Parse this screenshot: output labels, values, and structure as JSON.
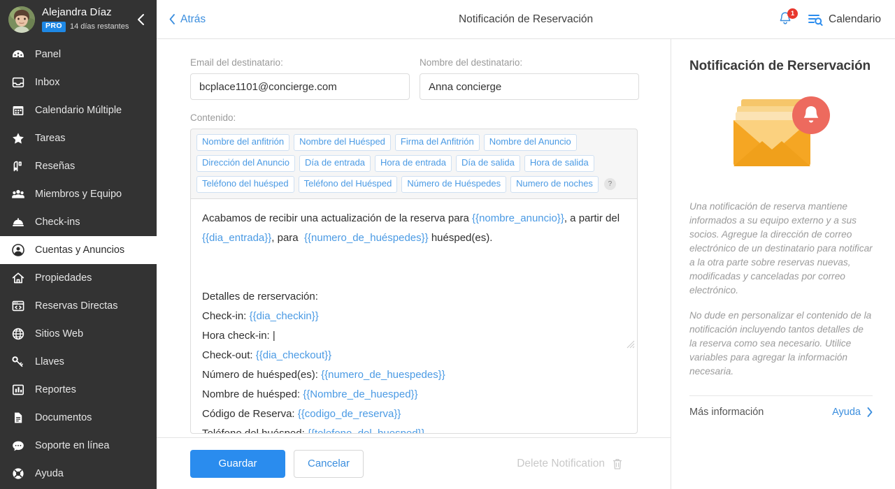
{
  "sidebar": {
    "user": {
      "name": "Alejandra Díaz",
      "badge": "PRO",
      "days_left": "14 días restantes"
    },
    "collapse_icon": "chevron-left-icon",
    "items": [
      {
        "label": "Panel",
        "icon": "dashboard-icon",
        "active": false
      },
      {
        "label": "Inbox",
        "icon": "inbox-icon",
        "active": false
      },
      {
        "label": "Calendario Múltiple",
        "icon": "calendar-icon",
        "active": false
      },
      {
        "label": "Tareas",
        "icon": "star-icon",
        "active": false
      },
      {
        "label": "Reseñas",
        "icon": "review-icon",
        "active": false
      },
      {
        "label": "Miembros y Equipo",
        "icon": "users-icon",
        "active": false
      },
      {
        "label": "Check-ins",
        "icon": "bell-desk-icon",
        "active": false
      },
      {
        "label": "Cuentas y Anuncios",
        "icon": "account-circle-icon",
        "active": true
      },
      {
        "label": "Propiedades",
        "icon": "home-icon",
        "active": false
      },
      {
        "label": "Reservas Directas",
        "icon": "browser-code-icon",
        "active": false
      },
      {
        "label": "Sitios Web",
        "icon": "globe-icon",
        "active": false
      },
      {
        "label": "Llaves",
        "icon": "key-icon",
        "active": false
      },
      {
        "label": "Reportes",
        "icon": "bar-chart-icon",
        "active": false
      },
      {
        "label": "Documentos",
        "icon": "document-icon",
        "active": false
      },
      {
        "label": "Soporte en línea",
        "icon": "chat-icon",
        "active": false
      },
      {
        "label": "Ayuda",
        "icon": "lifebuoy-icon",
        "active": false
      }
    ]
  },
  "topbar": {
    "back_label": "Atrás",
    "title": "Notificación de Reservación",
    "notifications_count": "1",
    "calendar_label": "Calendario"
  },
  "form": {
    "email_label": "Email del destinatario:",
    "email_value": "bcplace1101@concierge.com",
    "name_label": "Nombre del destinatario:",
    "name_value": "Anna concierge",
    "content_label": "Contenido:",
    "help_glyph": "?",
    "tags": [
      "Nombre del anfitrión",
      "Nombre del Huésped",
      "Firma del Anfitrión",
      "Nombre del Anuncio",
      "Dirección del Anuncio",
      "Día de entrada",
      "Hora de entrada",
      "Día de salida",
      "Hora de salida",
      "Teléfono del huésped",
      "Teléfono del Huésped",
      "Número de Huéspedes",
      "Numero de noches"
    ],
    "editor_lines": [
      {
        "parts": [
          {
            "t": "Acabamos de recibir una actualización de la reserva para ",
            "v": false
          },
          {
            "t": "{{nombre_anuncio}}",
            "v": true
          },
          {
            "t": ", a partir del ",
            "v": false
          },
          {
            "t": "{{dia_entrada}}",
            "v": true
          },
          {
            "t": ", para  ",
            "v": false
          },
          {
            "t": "{{numero_de_huéspedes}}",
            "v": true
          },
          {
            "t": " huésped(es).",
            "v": false
          }
        ]
      },
      {
        "parts": [
          {
            "t": "",
            "v": false
          }
        ]
      },
      {
        "parts": [
          {
            "t": "",
            "v": false
          }
        ]
      },
      {
        "parts": [
          {
            "t": "Detalles de rerservación:",
            "v": false
          }
        ]
      },
      {
        "parts": [
          {
            "t": "Check-in: ",
            "v": false
          },
          {
            "t": "{{dia_checkin}}",
            "v": true
          }
        ]
      },
      {
        "parts": [
          {
            "t": "Hora check-in: |",
            "v": false
          }
        ]
      },
      {
        "parts": [
          {
            "t": "Check-out: ",
            "v": false
          },
          {
            "t": "{{dia_checkout}}",
            "v": true
          }
        ]
      },
      {
        "parts": [
          {
            "t": "Número de huésped(es): ",
            "v": false
          },
          {
            "t": "{{numero_de_huespedes}}",
            "v": true
          }
        ]
      },
      {
        "parts": [
          {
            "t": "Nombre de huésped: ",
            "v": false
          },
          {
            "t": "{{Nombre_de_huesped}}",
            "v": true
          }
        ]
      },
      {
        "parts": [
          {
            "t": "Código de Reserva: ",
            "v": false
          },
          {
            "t": "{{codigo_de_reserva}}",
            "v": true
          }
        ]
      },
      {
        "parts": [
          {
            "t": "Teléfono del huésped: ",
            "v": false
          },
          {
            "t": "{{telefono_del_huesped}}",
            "v": true
          }
        ]
      }
    ]
  },
  "footer": {
    "save_label": "Guardar",
    "cancel_label": "Cancelar",
    "delete_label": "Delete Notification",
    "delete_icon": "trash-icon"
  },
  "aside": {
    "title": "Notificación de Rerservación",
    "illustration": "envelope-with-bell-icon",
    "paragraph1": "Una notificación de reserva mantiene informados a su equipo externo y a sus socios. Agregue la dirección de correo electrónico de un destinatario para notificar a la otra parte sobre reservas nuevas, modificadas y canceladas por correo electrónico.",
    "paragraph2": "No dude en personalizar el contenido de la notificación incluyendo tantos detalles de la reserva como sea necesario. Utilice variables para agregar la información necesaria.",
    "more_info_label": "Más información",
    "help_label": "Ayuda"
  },
  "colors": {
    "sidebar_bg": "#333333",
    "accent_blue": "#2a8cee",
    "link_blue": "#3b8ede",
    "badge_red": "#e8372d",
    "pro_blue": "#1e88e5",
    "envelope_yellow": "#f5a623",
    "bell_red": "#ed6a5e"
  }
}
